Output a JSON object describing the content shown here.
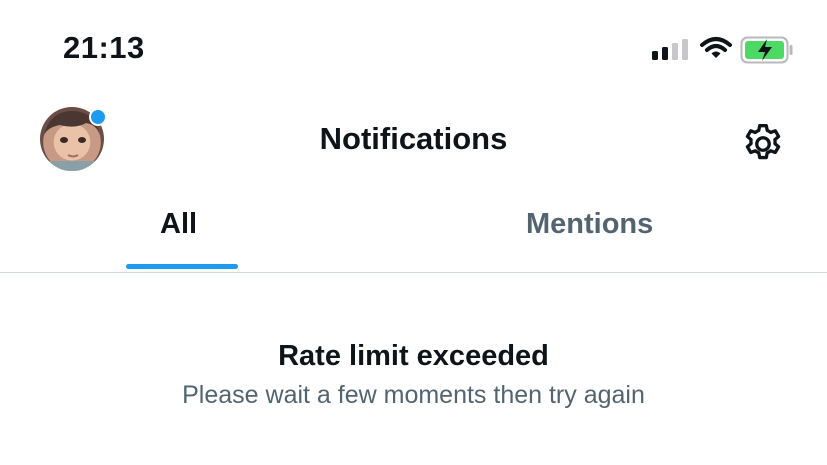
{
  "status_bar": {
    "time": "21:13",
    "signal_icon": "cellular-signal-icon",
    "wifi_icon": "wifi-icon",
    "battery_icon": "battery-charging-icon",
    "battery_color": "#4cd964"
  },
  "header": {
    "title": "Notifications",
    "avatar_icon": "profile-avatar",
    "settings_icon": "gear-icon",
    "notification_dot_color": "#1d9bf0"
  },
  "tabs": [
    {
      "label": "All",
      "selected": true
    },
    {
      "label": "Mentions",
      "selected": false
    }
  ],
  "message": {
    "title": "Rate limit exceeded",
    "subtitle": "Please wait a few moments then try again"
  },
  "colors": {
    "accent": "#1d9bf0",
    "text_primary": "#0f1419",
    "text_secondary": "#536471",
    "divider": "#cfd9de"
  }
}
